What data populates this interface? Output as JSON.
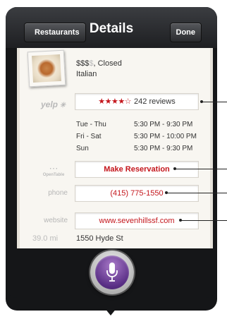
{
  "header": {
    "back_label": "Restaurants",
    "title": "Details",
    "done_label": "Done"
  },
  "business": {
    "price_active": "$$$",
    "price_dim": "$",
    "status": ", Closed",
    "cuisine": "Italian"
  },
  "yelp": {
    "logo_text": "yelp",
    "stars": "★★★★☆",
    "rating_value": 4.5,
    "reviews": "242 reviews"
  },
  "hours": [
    {
      "days": "Tue - Thu",
      "time": "5:30 PM -  9:30 PM"
    },
    {
      "days": "Fri - Sat",
      "time": "5:30 PM - 10:00 PM"
    },
    {
      "days": "Sun",
      "time": "5:30 PM -  9:30 PM"
    }
  ],
  "opentable": {
    "logo_text": "OpenTable",
    "action_label": "Make Reservation"
  },
  "phone": {
    "label": "phone",
    "value": "(415) 775-1550"
  },
  "website": {
    "label": "website",
    "value": "www.sevenhillssf.com"
  },
  "location": {
    "distance": "39.0 mi",
    "address": "1550 Hyde St"
  },
  "siri": {
    "icon": "microphone-icon",
    "accent_color": "#6a3a96"
  },
  "colors": {
    "link_red": "#c4161c",
    "background_dark": "#151618"
  }
}
